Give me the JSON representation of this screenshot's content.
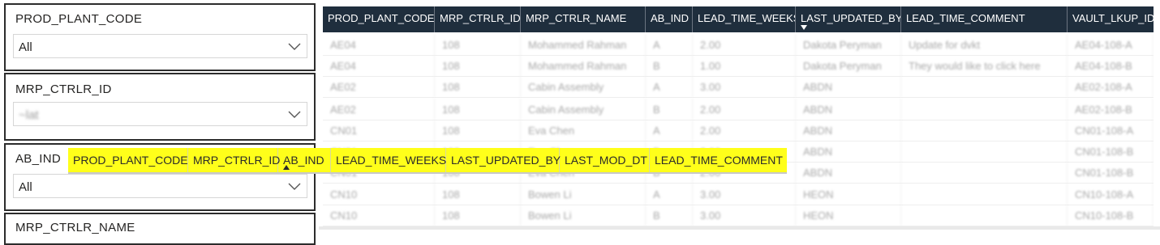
{
  "slicers": [
    {
      "title": "PROD_PLANT_CODE",
      "value": "All"
    },
    {
      "title": "MRP_CTRLR_ID",
      "value": "~lat"
    },
    {
      "title": "AB_IND",
      "value": "All"
    },
    {
      "title": "MRP_CTRLR_NAME"
    }
  ],
  "table": {
    "headers": [
      "PROD_PLANT_CODE",
      "MRP_CTRLR_ID",
      "MRP_CTRLR_NAME",
      "AB_IND",
      "LEAD_TIME_WEEKS",
      "LAST_UPDATED_BY",
      "LEAD_TIME_COMMENT",
      "VAULT_LKUP_ID"
    ],
    "sorted_column": "LAST_UPDATED_BY",
    "rows": [
      [
        "AE04",
        "108",
        "Mohammed Rahman",
        "A",
        "2.00",
        "Dakota Peryman",
        "Update for dvkt",
        "AE04-108-A"
      ],
      [
        "AE04",
        "108",
        "Mohammed Rahman",
        "B",
        "1.00",
        "Dakota Peryman",
        "They would like to click here",
        "AE04-108-B"
      ],
      [
        "AE02",
        "108",
        "Cabin Assembly",
        "A",
        "3.00",
        "ABDN",
        "",
        "AE02-108-A"
      ],
      [
        "AE02",
        "108",
        "Cabin Assembly",
        "B",
        "2.00",
        "ABDN",
        "",
        "AE02-108-B"
      ],
      [
        "CN01",
        "108",
        "Eva Chen",
        "A",
        "2.00",
        "ABDN",
        "",
        "CN01-108-A"
      ],
      [
        "CN01",
        "108",
        "Eva Chen",
        "B",
        "2.00",
        "ABDN",
        "",
        "CN01-108-B"
      ],
      [
        "CN01",
        "108",
        "Eva Chen",
        "B",
        "2.00",
        "ABDN",
        "",
        "CN01-108-B"
      ],
      [
        "CN10",
        "108",
        "Bowen Li",
        "A",
        "3.00",
        "HEON",
        "",
        "CN10-108-A"
      ],
      [
        "CN10",
        "108",
        "Bowen Li",
        "B",
        "3.00",
        "HEON",
        "",
        "CN10-108-B"
      ]
    ]
  },
  "field_popup": {
    "fields": [
      "PROD_PLANT_CODE",
      "MRP_CTRLR_ID",
      "AB_IND",
      "LEAD_TIME_WEEKS",
      "LAST_UPDATED_BY",
      "LAST_MOD_DT",
      "LEAD_TIME_COMMENT"
    ],
    "sorted_field": "AB_IND",
    "background": "#ffff1a"
  },
  "colors": {
    "header_bg": "#1f2e3d",
    "header_text": "#ffffff",
    "slicer_border": "#2c2c2c"
  },
  "icons": {
    "dropdown": "chevron-down-icon",
    "sort_desc": "sort-descending-icon",
    "sort_asc": "sort-ascending-icon"
  }
}
